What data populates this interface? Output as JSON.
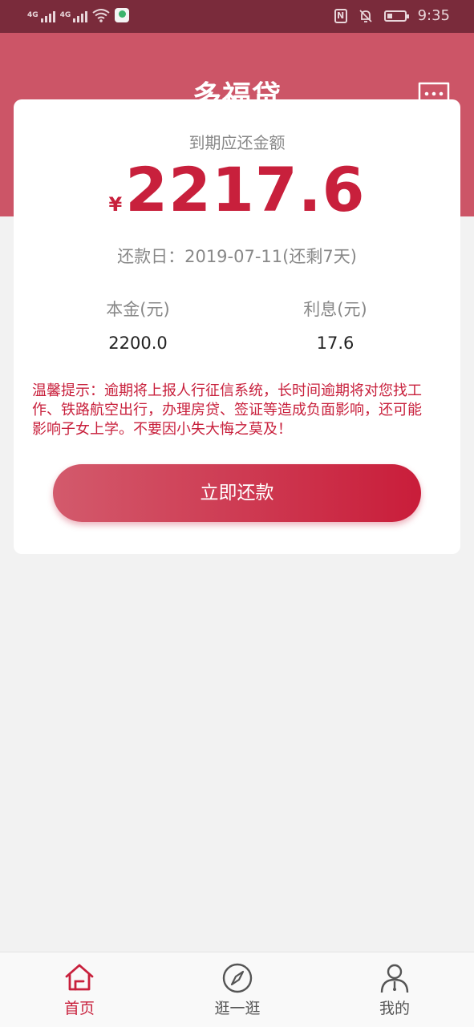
{
  "status_bar": {
    "net1": "4G",
    "net2": "4G",
    "time": "9:35",
    "nfc": "N"
  },
  "header": {
    "title": "多福贷",
    "message_icon": "chat-bubble-icon"
  },
  "card": {
    "due_label": "到期应还金额",
    "currency": "¥",
    "amount": "2217.6",
    "due_date": "还款日：2019-07-11(还剩7天)",
    "principal_label": "本金(元)",
    "principal_value": "2200.0",
    "interest_label": "利息(元)",
    "interest_value": "17.6",
    "notice": "温馨提示：逾期将上报人行征信系统，长时间逾期将对您找工作、铁路航空出行，办理房贷、签证等造成负面影响，还可能影响子女上学。不要因小失大悔之莫及！",
    "pay_button": "立即还款"
  },
  "tabs": [
    {
      "label": "首页",
      "icon": "home-icon",
      "active": true
    },
    {
      "label": "逛一逛",
      "icon": "compass-icon",
      "active": false
    },
    {
      "label": "我的",
      "icon": "user-icon",
      "active": false
    }
  ],
  "colors": {
    "header": "#cc5567",
    "status_bar": "#7a2b3b",
    "accent": "#c8203c"
  }
}
